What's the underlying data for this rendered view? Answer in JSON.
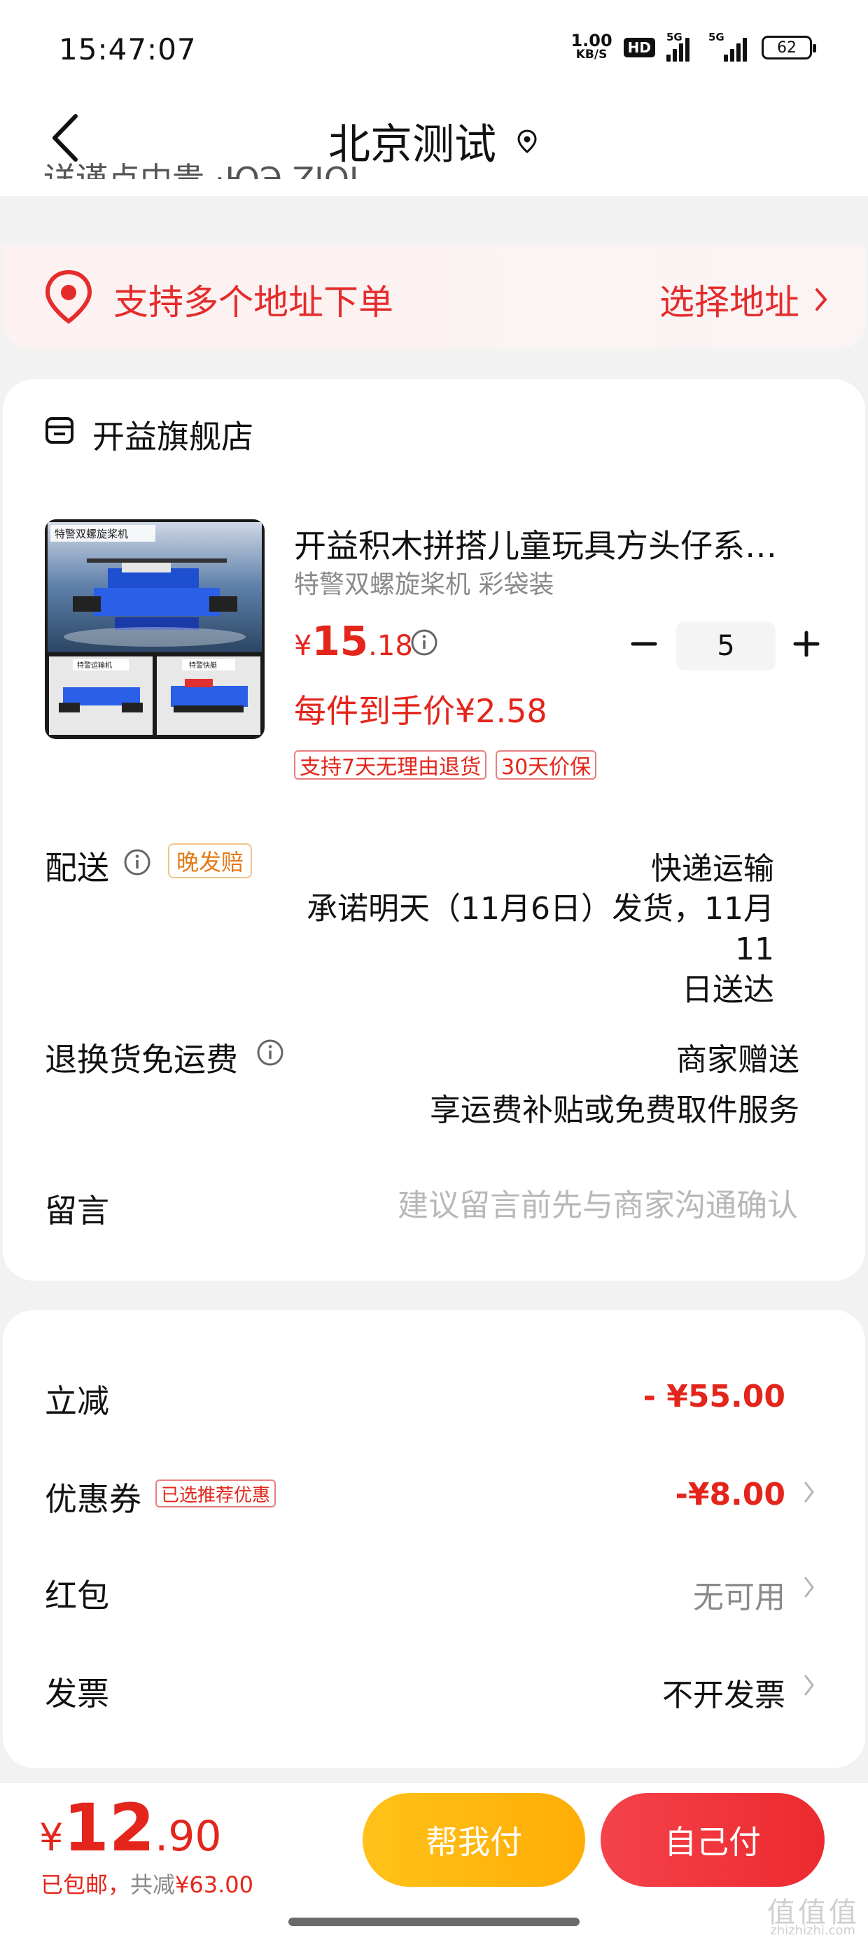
{
  "status_bar": {
    "time": "15:47:07",
    "net_speed_value": "1.00",
    "net_speed_unit": "KB/S",
    "hd_label": "HD",
    "signal1_label": "5G",
    "signal2_label": "5G",
    "battery": "62"
  },
  "header": {
    "title": "北京测试",
    "back_icon": "chevron-left-icon",
    "location_icon": "location-pin-icon",
    "cut_text": "详谨点中贵 ·ЮЭ   ZIOI"
  },
  "address_banner": {
    "text": "支持多个地址下单",
    "action": "选择地址",
    "accent": "#e52c2c"
  },
  "store": {
    "name": "开益旗舰店"
  },
  "product": {
    "title": "开益积木拼搭儿童玩具方头仔系列...",
    "sku": "特警双螺旋桨机 彩袋装",
    "image_labels": [
      "特警双螺旋桨机",
      "特警运输机",
      "特警快艇"
    ],
    "price_currency": "¥",
    "price_int": "15",
    "price_dec": ".18",
    "quantity": "5",
    "unit_price": "每件到手价¥2.58",
    "tags": [
      "支持7天无理由退货",
      "30天价保"
    ]
  },
  "delivery": {
    "label": "配送",
    "badge": "晚发赔",
    "method": "快递运输",
    "promise_line1": "承诺明天（11月6日）发货，11月11",
    "promise_line2": "日送达"
  },
  "return_shipping": {
    "label": "退换货免运费",
    "value": "商家赠送",
    "sub": "享运费补贴或免费取件服务"
  },
  "message": {
    "label": "留言",
    "placeholder": "建议留言前先与商家沟通确认",
    "value": ""
  },
  "discounts": {
    "instant": {
      "label": "立减",
      "value": "- ¥55.00"
    },
    "coupon": {
      "label": "优惠券",
      "badge": "已选推荐优惠",
      "value": "-¥8.00"
    },
    "red_packet": {
      "label": "红包",
      "value": "无可用"
    },
    "invoice": {
      "label": "发票",
      "value": "不开发票"
    }
  },
  "bottom": {
    "currency": "¥",
    "total_int": "12",
    "total_dec": ".90",
    "shipping_note": "已包邮，",
    "reduce_label": "共减",
    "reduce_value": "¥63.00",
    "btn_help": "帮我付",
    "btn_self": "自己付",
    "watermark": "值值值",
    "watermark_sub": "zhizhizhi.com"
  },
  "colors": {
    "red": "#e4251b",
    "yellow": "#ffb80f",
    "gray_text": "#8a8a8a"
  }
}
